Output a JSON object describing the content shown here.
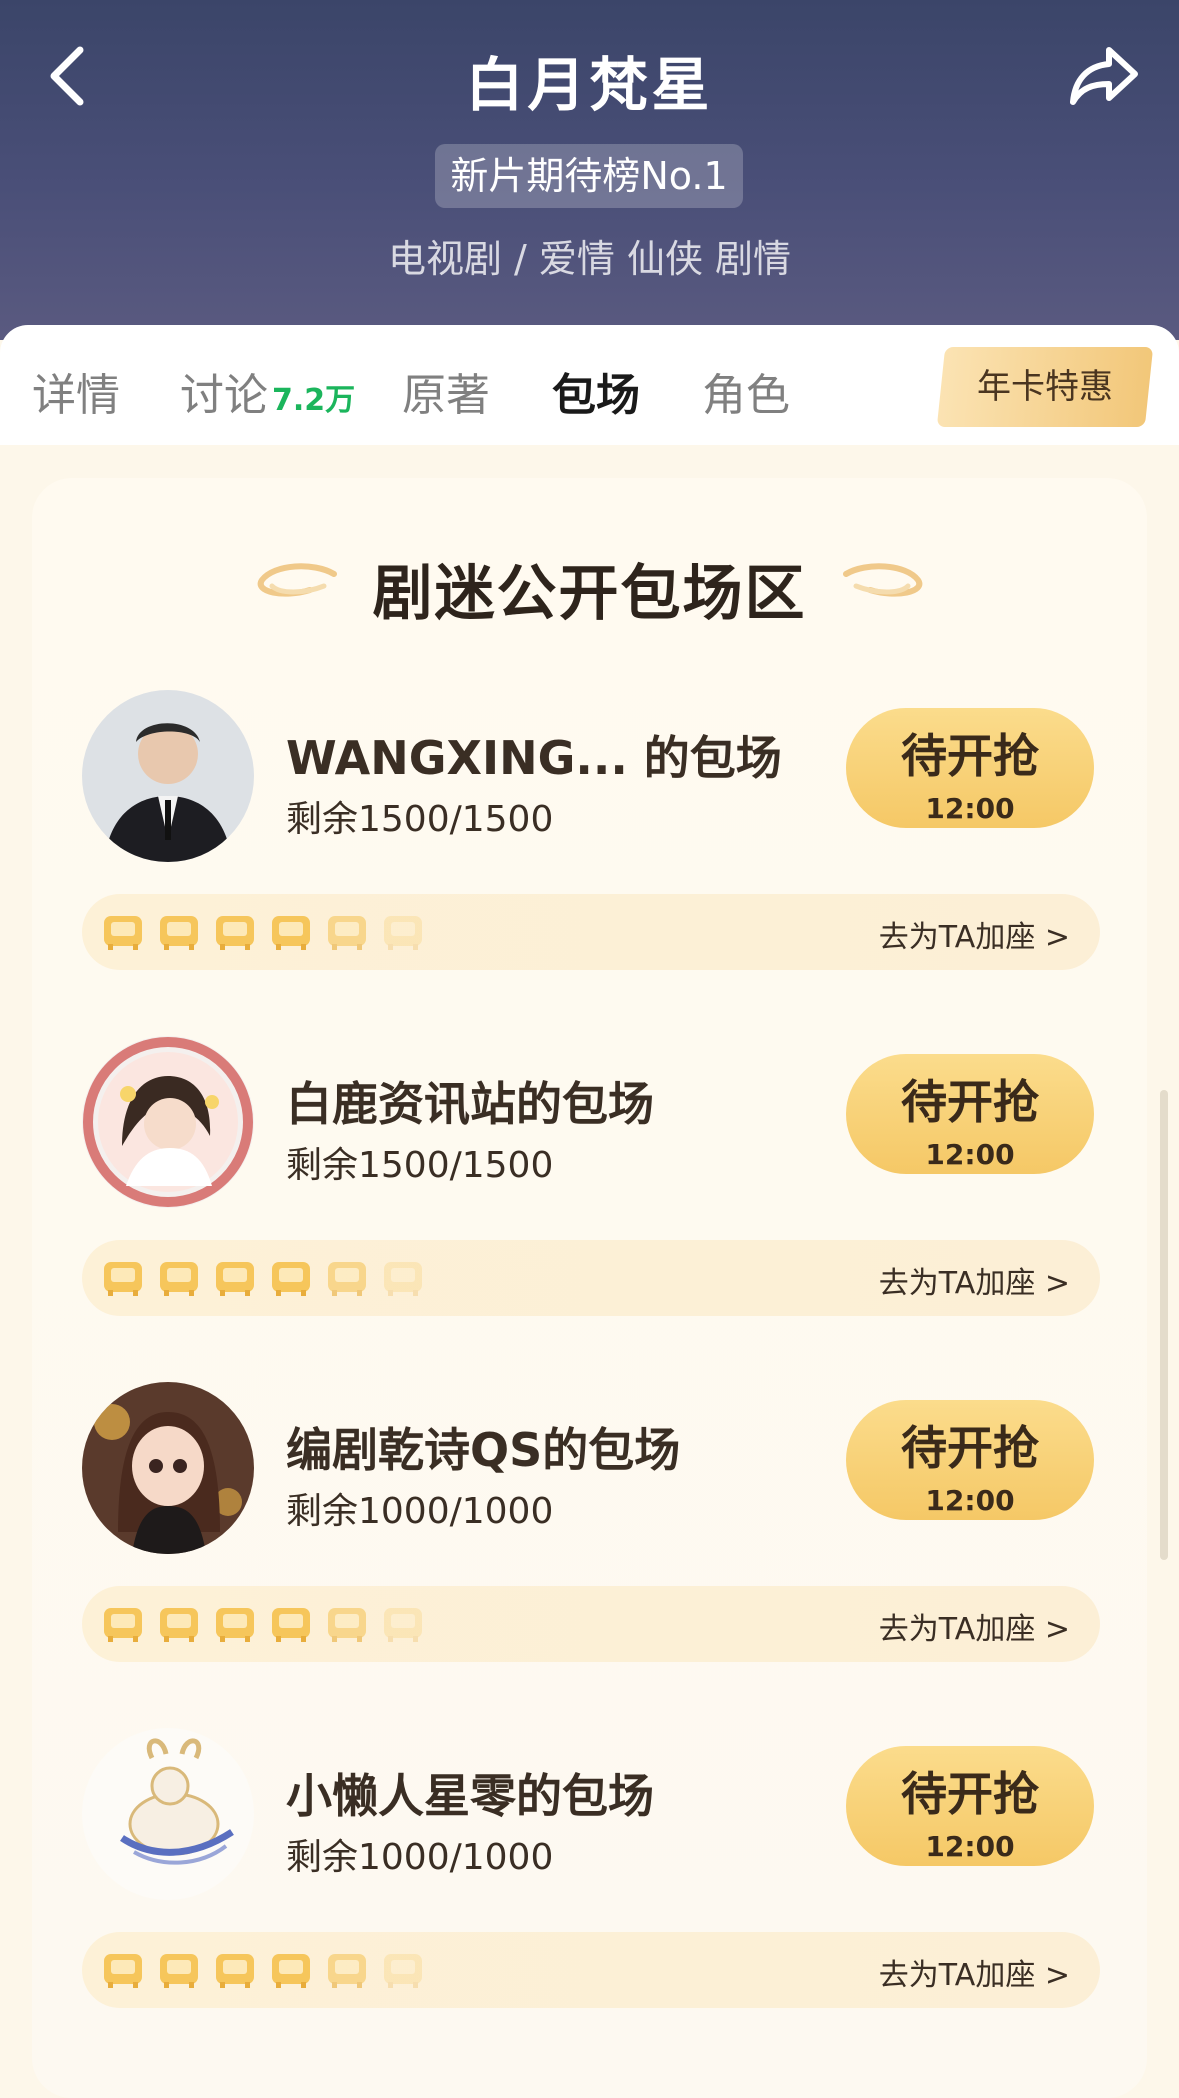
{
  "header": {
    "title": "白月梵星",
    "rank_badge": "新片期待榜No.1",
    "genres": "电视剧 / 爱情 仙侠 剧情"
  },
  "tabs": [
    {
      "label": "详情",
      "active": false
    },
    {
      "label": "讨论",
      "count": "7.2万",
      "active": false
    },
    {
      "label": "原著",
      "active": false
    },
    {
      "label": "包场",
      "active": true
    },
    {
      "label": "角色",
      "active": false
    }
  ],
  "promo_tab": "年卡特惠",
  "section_title": "剧迷公开包场区",
  "bookings": [
    {
      "name": "WANGXING...  的包场",
      "remaining": "剩余1500/1500",
      "button": "待开抢",
      "time": "12:00",
      "link": "去为TA加座 >"
    },
    {
      "name": "白鹿资讯站的包场",
      "remaining": "剩余1500/1500",
      "button": "待开抢",
      "time": "12:00",
      "link": "去为TA加座 >"
    },
    {
      "name": "编剧乾诗QS的包场",
      "remaining": "剩余1000/1000",
      "button": "待开抢",
      "time": "12:00",
      "link": "去为TA加座 >"
    },
    {
      "name": "小懒人星零的包场",
      "remaining": "剩余1000/1000",
      "button": "待开抢",
      "time": "12:00",
      "link": "去为TA加座 >"
    }
  ],
  "colors": {
    "header_top": "#3b4569",
    "accent_gold": "#f5c866",
    "count_green": "#1bb55c",
    "panel_bg": "#fffaf0"
  },
  "icons": [
    "back-icon",
    "share-icon",
    "seat-icon",
    "swirl-decoration-icon"
  ]
}
